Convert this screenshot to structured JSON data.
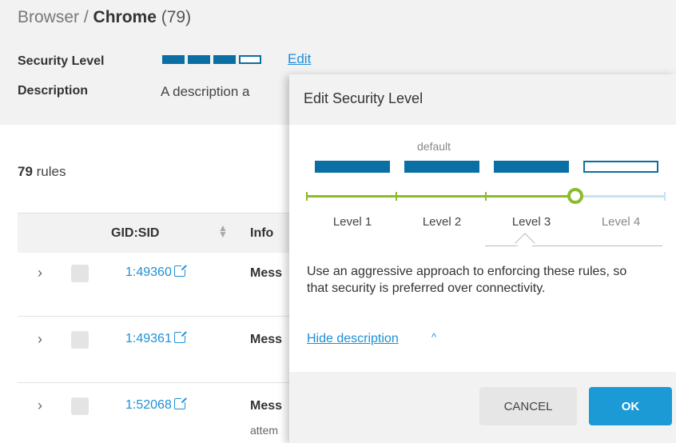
{
  "header": {
    "breadcrumb_parent": "Browser",
    "separator": " / ",
    "breadcrumb_current": "Chrome",
    "count": "(79)",
    "security_level_label": "Security Level",
    "security_bars": [
      "filled",
      "filled",
      "filled",
      "empty"
    ],
    "edit_label": "Edit",
    "description_label": "Description",
    "description_value": "A description a"
  },
  "rules": {
    "count": "79",
    "count_suffix": " rules",
    "columns": {
      "gid_sid": "GID:SID",
      "info": "Info"
    },
    "rows": [
      {
        "gid": "1:49360",
        "info": "Mess",
        "sub": ""
      },
      {
        "gid": "1:49361",
        "info": "Mess",
        "sub": ""
      },
      {
        "gid": "1:52068",
        "info": "Mess",
        "sub": "attem"
      }
    ]
  },
  "dialog": {
    "title": "Edit Security Level",
    "default_label": "default",
    "levels": [
      {
        "label": "Level 1",
        "state": "filled"
      },
      {
        "label": "Level 2",
        "state": "filled"
      },
      {
        "label": "Level 3",
        "state": "filled"
      },
      {
        "label": "Level 4",
        "state": "empty"
      }
    ],
    "selected_level": "Level 3",
    "description": "Use an aggressive approach to enforcing these rules, so that security is preferred over connectivity.",
    "hide_description_label": "Hide description",
    "cancel_label": "CANCEL",
    "ok_label": "OK"
  },
  "colors": {
    "accent_blue": "#0b6fa4",
    "link_blue": "#1e8fd6",
    "slider_green": "#8dbb2d",
    "slider_inactive": "#c6e3f2",
    "ok_button": "#1b9ad6"
  },
  "icons": {
    "external_link": "external-link-icon",
    "expand": "chevron-right-icon",
    "sort": "sort-icon",
    "collapse": "chevron-up-icon"
  }
}
